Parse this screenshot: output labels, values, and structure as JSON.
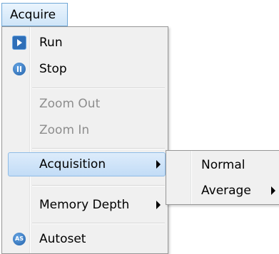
{
  "menubar": {
    "acquire_label": "Acquire"
  },
  "menu": {
    "items": [
      {
        "label": "Run",
        "icon": "play-icon"
      },
      {
        "label": "Stop",
        "icon": "pause-icon"
      },
      {
        "label": "Zoom Out",
        "disabled": true
      },
      {
        "label": "Zoom In",
        "disabled": true
      },
      {
        "label": "Acquisition",
        "has_submenu": true,
        "highlighted": true
      },
      {
        "label": "Memory Depth",
        "has_submenu": true
      },
      {
        "label": "Autoset",
        "icon": "autoset-icon"
      }
    ]
  },
  "submenu": {
    "items": [
      {
        "label": "Normal"
      },
      {
        "label": "Average",
        "has_submenu": true
      }
    ]
  },
  "colors": {
    "highlight": "#c9e0f7",
    "highlight_border": "#8fbce6",
    "icon_blue": "#1f5fa8",
    "disabled_text": "#8d8d8d"
  }
}
